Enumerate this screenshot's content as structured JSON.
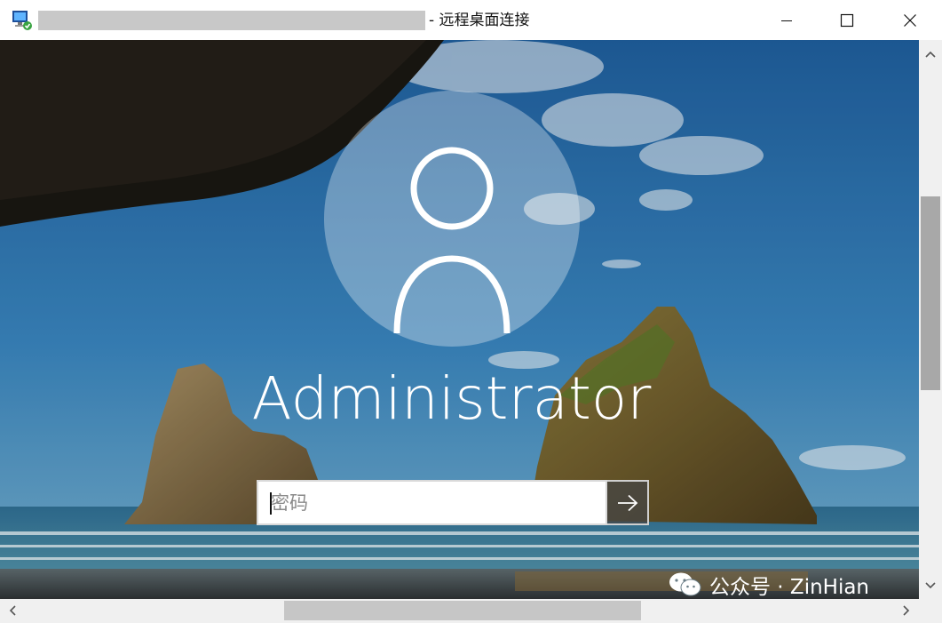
{
  "window": {
    "title_suffix": "- 远程桌面连接"
  },
  "login": {
    "username": "Administrator",
    "password_placeholder": "密码"
  },
  "watermark": {
    "text": "公众号 · ZinHian"
  },
  "colors": {
    "sky": "#2f78b8",
    "sea": "#3b88b0",
    "avatar_circle": "#ffffff",
    "scrollbar_track": "#f0f0f0"
  }
}
